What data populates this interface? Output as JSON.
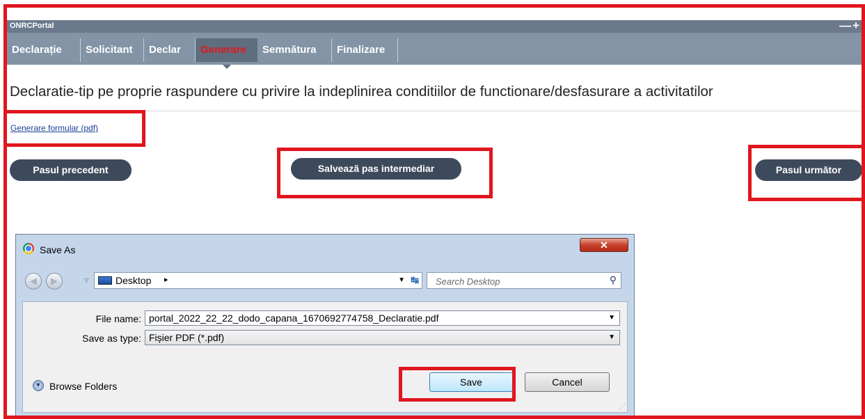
{
  "portal": {
    "title": "ONRCPortal",
    "window_controls": "—+",
    "tabs": [
      {
        "label": "Declarație",
        "active": false
      },
      {
        "label": "Solicitant",
        "active": false
      },
      {
        "label": "Declar",
        "active": false
      },
      {
        "label": "Generare",
        "active": true
      },
      {
        "label": "Semnătura",
        "active": false
      },
      {
        "label": "Finalizare",
        "active": false
      }
    ],
    "heading": "Declaratie-tip pe proprie raspundere cu privire la indeplinirea conditiilor de functionare/desfasurare a activitatilor",
    "pdf_link": "Generare formular (pdf)",
    "buttons": {
      "previous": "Pasul precedent",
      "save_intermediate": "Salvează pas intermediar",
      "next": "Pasul următor"
    }
  },
  "dialog": {
    "title": "Save As",
    "close_icon": "x-icon",
    "location": "Desktop",
    "location_arrow": "▸",
    "search_placeholder": "Search Desktop",
    "file_name_label": "File name:",
    "file_name_value": "portal_2022_22_22_dodo_capana_1670692774758_Declaratie.pdf",
    "save_type_label": "Save as type:",
    "save_type_value": "Fișier PDF (*.pdf)",
    "browse_label": "Browse Folders",
    "save_button": "Save",
    "cancel_button": "Cancel"
  },
  "colors": {
    "annotation_red": "#e0161e",
    "tab_bar": "#8294a6",
    "active_tab_text": "#e01818",
    "pill_button": "#3d4a5c",
    "dialog_frame": "#c5d6eb"
  }
}
